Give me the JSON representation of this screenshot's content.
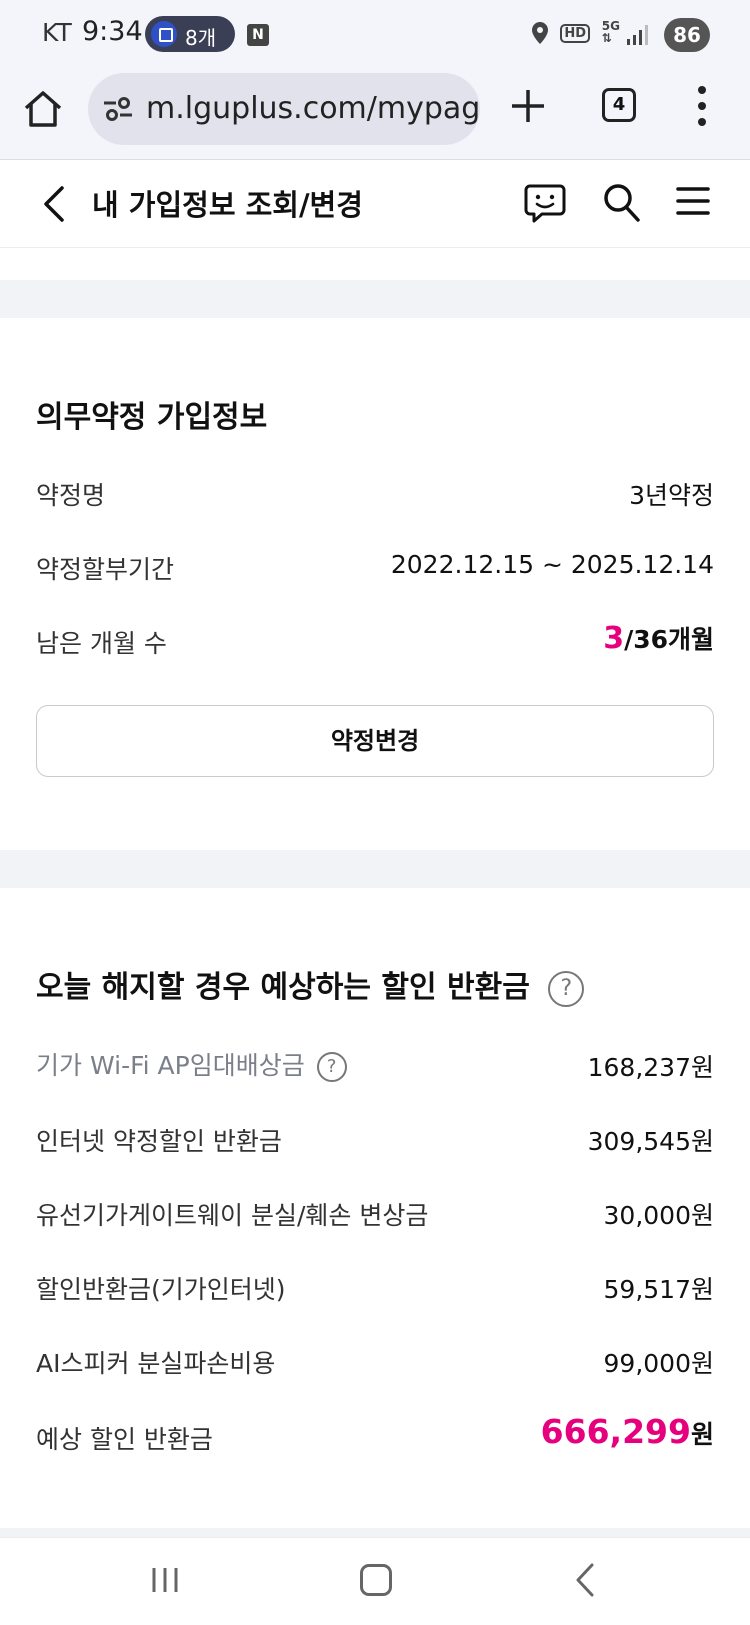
{
  "status_bar": {
    "carrier": "KT",
    "time": "9:34",
    "notification_count": "8개",
    "notification_icon": "subway-icon",
    "app_badge": "N",
    "battery": "86"
  },
  "browser": {
    "url": "m.lguplus.com/mypag",
    "tab_count": "4"
  },
  "header": {
    "title": "내 가입정보 조회/변경"
  },
  "contract": {
    "section_title": "의무약정 가입정보",
    "rows": [
      {
        "label": "약정명",
        "value": "3년약정"
      },
      {
        "label": "약정할부기간",
        "value": "2022.12.15 ~ 2025.12.14"
      },
      {
        "label": "남은 개월 수",
        "value_accent": "3",
        "value_rest": "/36개월"
      }
    ],
    "change_button": "약정변경"
  },
  "refund": {
    "section_title": "오늘 해지할 경우 예상하는 할인 반환금",
    "help_glyph": "?",
    "rows": [
      {
        "label": "기가 Wi-Fi AP임대배상금",
        "value": "168,237원"
      },
      {
        "label": "인터넷 약정할인 반환금",
        "value": "309,545원"
      },
      {
        "label": "유선기가게이트웨이 분실/훼손 변상금",
        "value": "30,000원"
      },
      {
        "label": "할인반환금(기가인터넷)",
        "value": "59,517원"
      },
      {
        "label": "AI스피커 분실파손비용",
        "value": "99,000원"
      }
    ],
    "total_label": "예상 할인 반환금",
    "total_amount": "666,299",
    "total_unit": "원"
  },
  "colors": {
    "accent": "#e6007e",
    "gap_background": "#f2f3f6",
    "browser_background": "#f4f4fb"
  }
}
